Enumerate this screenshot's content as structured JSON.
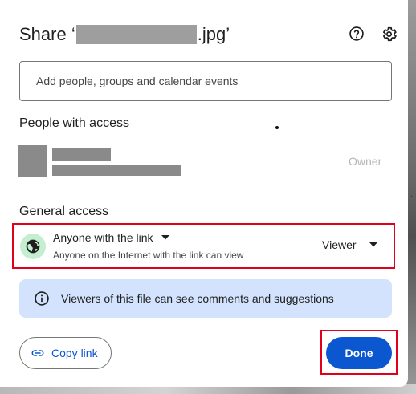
{
  "dialog": {
    "title_prefix": "Share ‘",
    "title_suffix": ".jpg’"
  },
  "icons": {
    "help": "help-circle-icon",
    "settings": "gear-icon",
    "globe": "globe-icon",
    "caret": "caret-down-icon",
    "info": "info-icon",
    "link": "link-icon"
  },
  "add_people": {
    "placeholder": "Add people, groups and calendar events"
  },
  "people_with_access": {
    "label": "People with access",
    "entries": [
      {
        "role": "Owner"
      }
    ]
  },
  "general_access": {
    "label": "General access",
    "type": "Anyone with the link",
    "description": "Anyone on the Internet with the link can view",
    "role": "Viewer"
  },
  "info_banner": {
    "message": "Viewers of this file can see comments and suggestions"
  },
  "footer": {
    "copy_link_label": "Copy link",
    "done_label": "Done"
  },
  "colors": {
    "accent": "#0b57d0",
    "banner_bg": "#d3e3fd",
    "globe_bg": "#c4eed0",
    "highlight": "#e0001a"
  }
}
